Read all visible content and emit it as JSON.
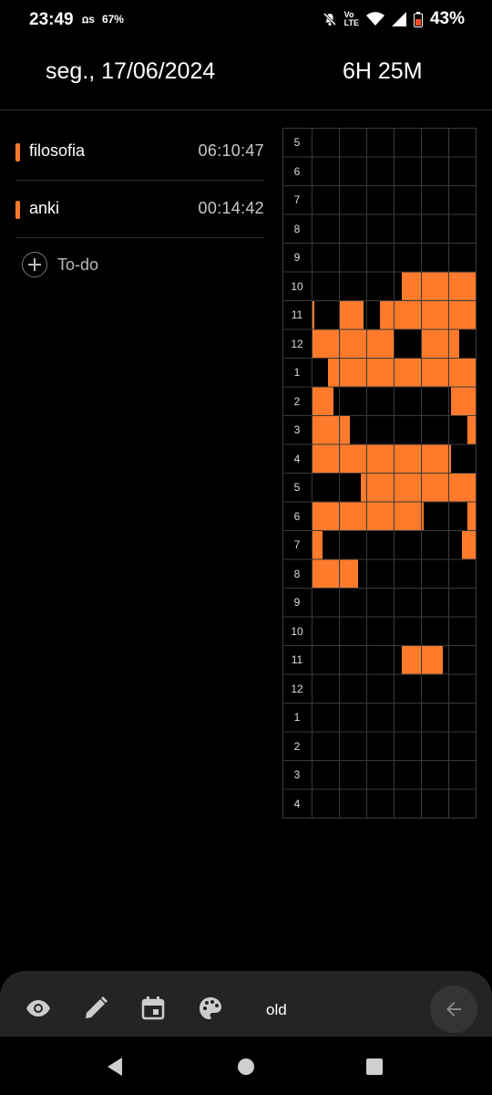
{
  "status_bar": {
    "time": "23:49",
    "left_badge": "ꭥs",
    "data_usage": "67%",
    "network_label": "Vo\nLTE",
    "battery": "43%"
  },
  "header": {
    "date": "seg., 17/06/2024",
    "total": "6H 25M"
  },
  "tasks": [
    {
      "name": "filosofia",
      "time": "06:10:47",
      "color": "#ff7a2b"
    },
    {
      "name": "anki",
      "time": "00:14:42",
      "color": "#ff7a2b"
    }
  ],
  "todo_label": "To-do",
  "grid": {
    "hours": [
      "5",
      "6",
      "7",
      "8",
      "9",
      "10",
      "11",
      "12",
      "1",
      "2",
      "3",
      "4",
      "5",
      "6",
      "7",
      "8",
      "9",
      "10",
      "11",
      "12",
      "1",
      "2",
      "3",
      "4"
    ],
    "columns": 6,
    "fill_color": "#ff7a2b",
    "filled_spans": [
      {
        "row": 5,
        "from": 3.3,
        "to": 6
      },
      {
        "row": 6,
        "from": 0,
        "to": 0.1
      },
      {
        "row": 6,
        "from": 1,
        "to": 1.9
      },
      {
        "row": 6,
        "from": 2.5,
        "to": 6
      },
      {
        "row": 7,
        "from": 0,
        "to": 3
      },
      {
        "row": 7,
        "from": 4,
        "to": 5.4
      },
      {
        "row": 8,
        "from": 0.6,
        "to": 6
      },
      {
        "row": 9,
        "from": 0,
        "to": 0.8
      },
      {
        "row": 9,
        "from": 5.1,
        "to": 6
      },
      {
        "row": 10,
        "from": 0,
        "to": 1.4
      },
      {
        "row": 10,
        "from": 5.7,
        "to": 6
      },
      {
        "row": 11,
        "from": 0,
        "to": 5.1
      },
      {
        "row": 12,
        "from": 1.8,
        "to": 6
      },
      {
        "row": 13,
        "from": 0,
        "to": 4.1
      },
      {
        "row": 13,
        "from": 5.7,
        "to": 6
      },
      {
        "row": 14,
        "from": 0,
        "to": 0.4
      },
      {
        "row": 14,
        "from": 5.5,
        "to": 6
      },
      {
        "row": 15,
        "from": 0,
        "to": 1.7
      },
      {
        "row": 18,
        "from": 3.3,
        "to": 4.8
      }
    ]
  },
  "bottom_bar": {
    "icons": [
      "eye-icon",
      "pencil-icon",
      "calendar-icon",
      "palette-icon"
    ],
    "mode_label": "old"
  }
}
